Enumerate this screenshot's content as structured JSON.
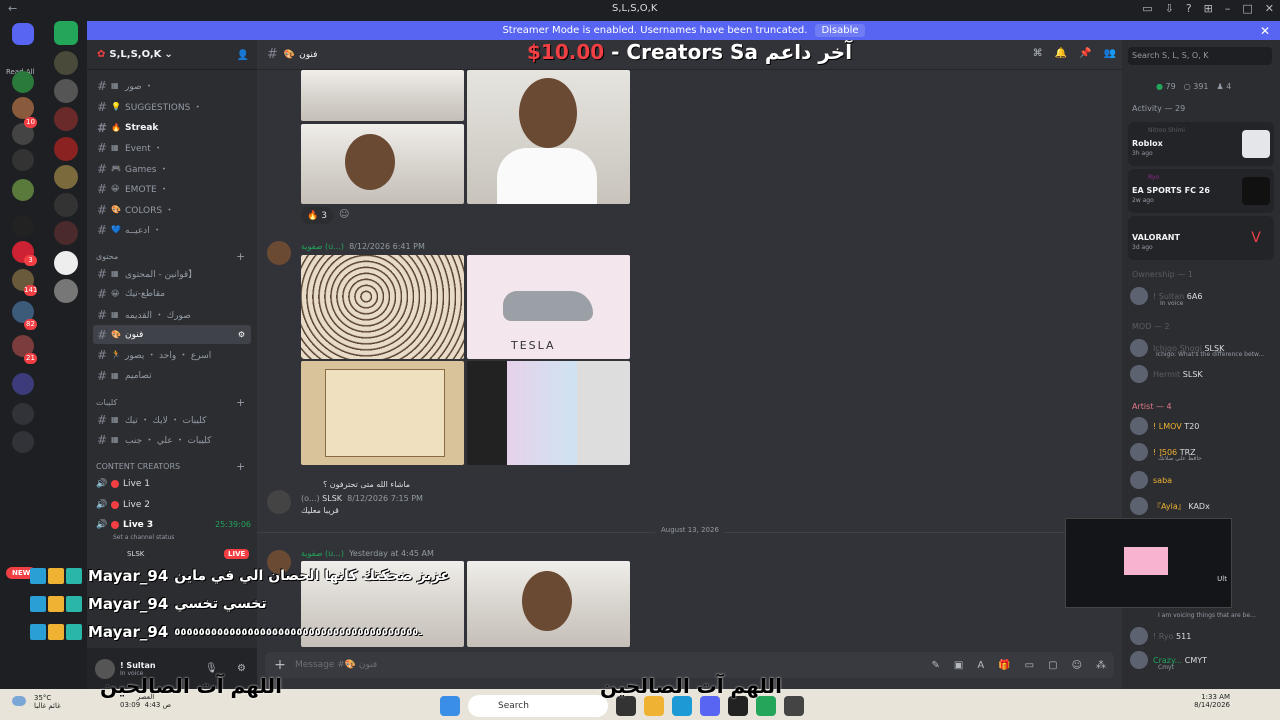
{
  "window": {
    "title": "S,L,S,O,K",
    "back": "←"
  },
  "banner": {
    "text": "Streamer Mode is enabled. Usernames have been truncated.",
    "disable": "Disable"
  },
  "rail": {
    "read_all": "Read All"
  },
  "server": {
    "name": "S,L,S,O,K",
    "channels": [
      {
        "label": "صور ・",
        "emoji": "▦"
      },
      {
        "label": "SUGGESTIONS ・",
        "emoji": "💡"
      },
      {
        "label": "Streak",
        "emoji": "🔥",
        "bold": true
      },
      {
        "label": "Event ・",
        "emoji": "▦"
      },
      {
        "label": "Games ・",
        "emoji": "🎮"
      },
      {
        "label": "EMOTE ・",
        "emoji": "😀"
      },
      {
        "label": "COLORS ・",
        "emoji": "🎨"
      },
      {
        "label": "ادعيــه ・",
        "emoji": "💙"
      }
    ],
    "category1": "محتوى",
    "channels2": [
      {
        "label": "قوانين - المحتوى】",
        "emoji": "▦"
      },
      {
        "label": "مقاطع-تيك",
        "emoji": "😀"
      },
      {
        "label": "صورك ・ القديمه",
        "emoji": "▦"
      },
      {
        "label": "فنون",
        "emoji": "🎨",
        "active": true
      },
      {
        "label": "اسرع ・ واحد ・ يصور",
        "emoji": "🏃"
      },
      {
        "label": "تصاميم",
        "emoji": "▦"
      }
    ],
    "category2": "كليبات",
    "channels3": [
      {
        "label": "كليبات ・ لايك ・ تيك",
        "emoji": "▦"
      },
      {
        "label": "كليبات ・ علي ・ جنب",
        "emoji": "▦"
      }
    ],
    "category3": "CONTENT CREATORS",
    "voice": [
      {
        "label": "Live 1"
      },
      {
        "label": "Live 2"
      },
      {
        "label": "Live 3",
        "time": "25:39:06"
      }
    ],
    "voice_status": "Set a channel status",
    "voice_user": "SLSK",
    "live_tag": "LIVE",
    "new_tag": "NEW"
  },
  "user": {
    "name": "! Sultan",
    "status": "In voice"
  },
  "channel": {
    "name": "فنون"
  },
  "stream_overlay": {
    "price": "$10.00",
    "text": " - Creators Sa آخر داعم"
  },
  "messages": [
    {
      "reaction_emoji": "🔥",
      "reaction_count": "3"
    },
    {
      "author": "صفوية (u...)",
      "time": "8/12/2026 6:41 PM"
    },
    {
      "reply_snippet": "ماشاء الله متى تحترفون ؟",
      "author": "(o...)",
      "tag": "SLSK",
      "time": "8/12/2026 7:15 PM",
      "text": "قريبا معليك"
    },
    {
      "author": "صفوية (u...)",
      "time": "Yesterday at 4:45 AM"
    }
  ],
  "date_divider": "August 13, 2026",
  "composer": {
    "placeholder": "Message #🎨 فنون"
  },
  "right": {
    "search": "Search S, L, S, O, K",
    "online": "79",
    "members": "391",
    "boost": "4",
    "activity_header": "Activity — 29",
    "activities": [
      {
        "user": "Nitroo Shimi",
        "game": "Roblox",
        "ago": "3h ago"
      },
      {
        "user": "Ryo",
        "game": "EA SPORTS FC 26",
        "ago": "2w ago"
      },
      {
        "user": "",
        "game": "VALORANT",
        "ago": "3d ago"
      }
    ],
    "ownership": "Ownership — 1",
    "owner": {
      "name": "! Sultan",
      "badge": "6A6",
      "status": "In voice"
    },
    "mod": "MOD — 2",
    "mods": [
      {
        "name": "Ichigo Shogi",
        "badge": "SLSK",
        "status": "Ichigo: What's the difference betw..."
      },
      {
        "name": "Hermit",
        "badge": "SLSK"
      }
    ],
    "artist": "Artist — 4",
    "artists": [
      {
        "name": "! LMOV",
        "badge": "T20"
      },
      {
        "name": "! ]506",
        "badge": "TRZ",
        "status": "حافظ على صلاتك"
      },
      {
        "name": "saba"
      },
      {
        "name": "『Ayla』",
        "badge": "KADx"
      }
    ],
    "bottom_members": [
      {
        "name": "I am voicing things that are be..."
      },
      {
        "name": "! Ryo",
        "badge": "511"
      },
      {
        "name": "Crazy...",
        "badge": "CMYT",
        "status": "Cmyt"
      }
    ],
    "pip_label": "Ult"
  },
  "overlay_chat": [
    {
      "name": "Mayar_94",
      "msg": "عزيز ضحكتك كانها الحصان الي في ماين"
    },
    {
      "name": "Mayar_94",
      "msg": "تخسي تخسي"
    },
    {
      "name": "Mayar_94",
      "msg": "ـ٥٥٥٥٥٥٥٥٥٥٥٥٥٥٥٥٥٥٥٥٥٥٥٥٥٥٥٥٥٥٥٥٥٥٥٥٥٥٥٥"
    }
  ],
  "taskbar": {
    "weather_temp": "35°C",
    "weather_desc": "غائم غالبا",
    "prayer_label": "العصر",
    "prayer_time1": "03:09",
    "prayer_time2": "4:43 ص",
    "search": "Search",
    "clock": "1:33 AM",
    "date": "8/14/2026"
  },
  "subtitles": {
    "line1": "اللهم آت الصالحين",
    "line2": "اللهم آت الصالحين"
  },
  "colors": {
    "accent": "#5865f2",
    "online": "#23a55a",
    "danger": "#f23f43"
  }
}
